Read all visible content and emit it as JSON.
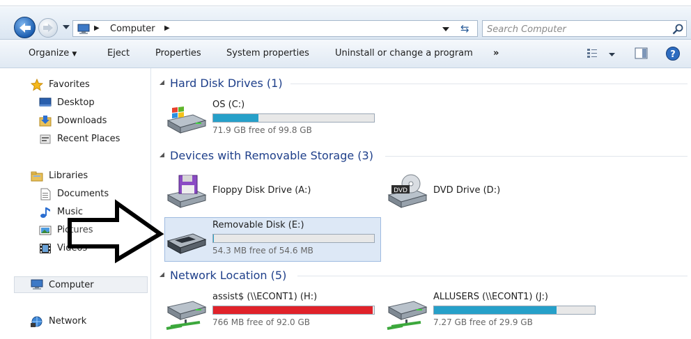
{
  "address": {
    "crumb": "Computer",
    "search_placeholder": "Search Computer"
  },
  "toolbar": {
    "organize": "Organize",
    "eject": "Eject",
    "properties": "Properties",
    "system_properties": "System properties",
    "uninstall": "Uninstall or change a program",
    "more": "»"
  },
  "nav": {
    "favorites": "Favorites",
    "desktop": "Desktop",
    "downloads": "Downloads",
    "recent_places": "Recent Places",
    "libraries": "Libraries",
    "documents": "Documents",
    "music": "Music",
    "pictures": "Pictures",
    "videos": "Videos",
    "computer": "Computer",
    "network": "Network"
  },
  "groups": {
    "hard_disk": "Hard Disk Drives (1)",
    "removable": "Devices with Removable Storage (3)",
    "network": "Network Location (5)"
  },
  "drives": {
    "os": {
      "name": "OS (C:)",
      "free": "71.9 GB free of 99.8 GB",
      "used_fraction": 0.28
    },
    "floppy": {
      "name": "Floppy Disk Drive (A:)"
    },
    "dvd": {
      "name": "DVD Drive (D:)",
      "badge": "DVD"
    },
    "removable": {
      "name": "Removable Disk (E:)",
      "free": "54.3 MB free of 54.6 MB",
      "used_fraction": 0.005
    },
    "assist": {
      "name": "assist$ (\\\\ECONT1) (H:)",
      "free": "766 MB free of 92.0 GB",
      "used_fraction": 0.99
    },
    "allusers": {
      "name": "ALLUSERS (\\\\ECONT1) (J:)",
      "free": "7.27 GB free of 29.9 GB",
      "used_fraction": 0.76
    }
  },
  "colors": {
    "bar_normal": "#26a0c9",
    "bar_full": "#e0222a",
    "group_title": "#1e3f8a",
    "selection": "#dde8f6"
  }
}
